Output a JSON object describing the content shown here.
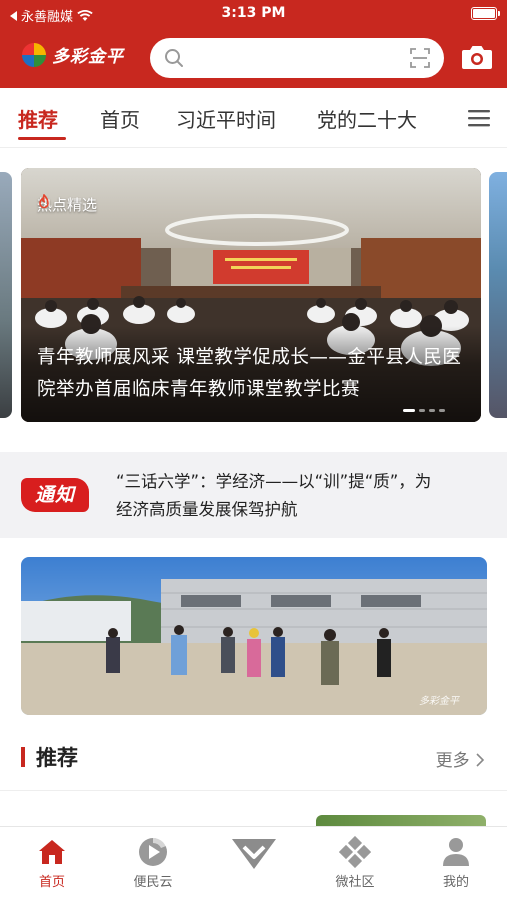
{
  "status_bar": {
    "carrier": "永善融媒",
    "time": "3:13 PM"
  },
  "header": {
    "app_name": "多彩金平",
    "search_placeholder": "",
    "icons": [
      "search-icon",
      "scan-icon",
      "camera-icon"
    ],
    "brand_color": "#c8281f"
  },
  "tabs": [
    {
      "label": "推荐",
      "active": true
    },
    {
      "label": "首页",
      "active": false
    },
    {
      "label": "习近平时间",
      "active": false
    },
    {
      "label": "党的二十大",
      "active": false
    }
  ],
  "carousel": {
    "tag": "热点精选",
    "title": "青年教师展风采 课堂教学促成长——金平县人民医院举办首届临床青年教师课堂教学比赛",
    "active_index": 0,
    "dot_count": 4
  },
  "notice": {
    "badge": "通知",
    "text": "“三话六学”：学经济——以“训”提“质”，为经济高质量发展保驾护航"
  },
  "banner": {
    "watermark": "多彩金平"
  },
  "recommend": {
    "title": "推荐",
    "more_label": "更多"
  },
  "bottom_nav": [
    {
      "label": "首页",
      "icon": "home-icon",
      "active": true
    },
    {
      "label": "便民云",
      "icon": "cloud-service-icon",
      "active": false
    },
    {
      "label": "",
      "icon": "heart-diamond-icon",
      "active": false
    },
    {
      "label": "微社区",
      "icon": "community-icon",
      "active": false
    },
    {
      "label": "我的",
      "icon": "user-icon",
      "active": false
    }
  ]
}
